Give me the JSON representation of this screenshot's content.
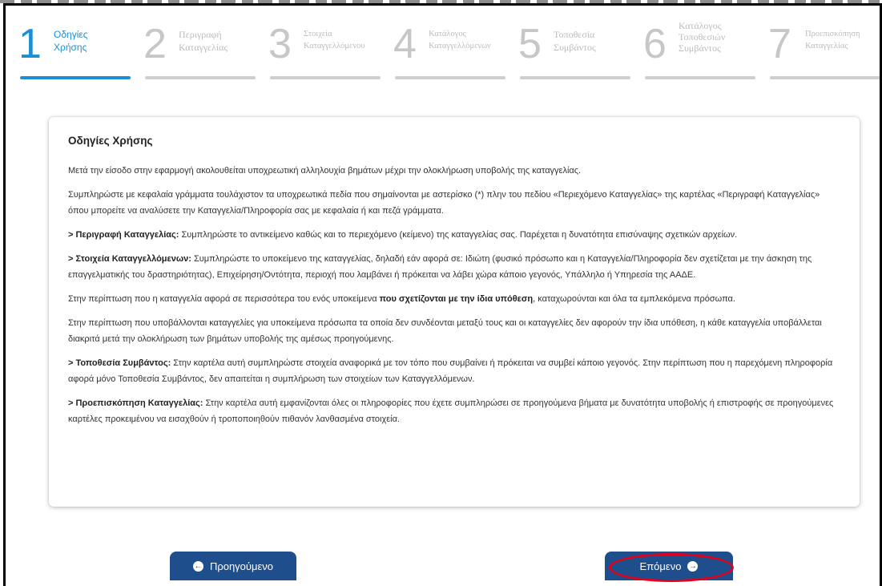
{
  "steps": [
    {
      "num": "1",
      "label_line1": "Οδηγίες",
      "label_line2": "Χρήσης"
    },
    {
      "num": "2",
      "label_line1": "Περιγραφή",
      "label_line2": "Καταγγελίας"
    },
    {
      "num": "3",
      "label_line1": "Στοιχεία",
      "label_line2": "Καταγγελλόμενου"
    },
    {
      "num": "4",
      "label_line1": "Κατάλογος",
      "label_line2": "Καταγγελλόμενων"
    },
    {
      "num": "5",
      "label_line1": "Τοποθεσία",
      "label_line2": "Συμβάντος"
    },
    {
      "num": "6",
      "label_line1": "Κατάλογος",
      "label_line2": "Τοποθεσιών",
      "label_line3": "Συμβάντος"
    },
    {
      "num": "7",
      "label_line1": "Προεπισκόπηση",
      "label_line2": "Καταγγελίας"
    }
  ],
  "colors": {
    "active": "#1a8fd6",
    "inactive": "#c7c7c7",
    "button": "#1f4e8c",
    "highlight": "#e3001b"
  },
  "card": {
    "title": "Οδηγίες Χρήσης",
    "p1": "Μετά την είσοδο στην εφαρμογή ακολουθείται υποχρεωτική αλληλουχία βημάτων μέχρι την ολοκλήρωση υποβολής της καταγγελίας.",
    "p2": "Συμπληρώστε με κεφαλαία γράμματα τουλάχιστον τα υποχρεωτικά πεδία που σημαίνονται με αστερίσκο (*) πλην του πεδίου «Περιεχόμενο Καταγγελίας» της καρτέλας «Περιγραφή Καταγγελίας» όπου μπορείτε να αναλύσετε την Καταγγελία/Πληροφορία σας με κεφαλαία ή και πεζά γράμματα.",
    "p3_bold": "> Περιγραφή Καταγγελίας:",
    "p3_text": " Συμπληρώστε το αντικείμενο καθώς και το περιεχόμενο (κείμενο) της καταγγελίας σας. Παρέχεται η δυνατότητα επισύναψης σχετικών αρχείων.",
    "p4_bold": "> Στοιχεία Καταγγελλόμενων:",
    "p4_text": " Συμπληρώστε το υποκείμενο της καταγγελίας, δηλαδή εάν αφορά σε: Ιδιώτη (φυσικό πρόσωπο και η Καταγγελία/Πληροφορία δεν σχετίζεται με την άσκηση της επαγγελματικής του δραστηριότητας), Επιχείρηση/Οντότητα, περιοχή που λαμβάνει ή πρόκειται να λάβει χώρα κάποιο γεγονός, Υπάλληλο ή Υπηρεσία της ΑΑΔΕ.",
    "p5_pre": "Στην περίπτωση που η καταγγελία αφορά σε περισσότερα του ενός υποκείμενα ",
    "p5_bold": "που σχετίζονται με την ίδια υπόθεση",
    "p5_post": ", καταχωρούνται και όλα τα εμπλεκόμενα πρόσωπα.",
    "p6": "Στην περίπτωση που υποβάλλονται καταγγελίες για υποκείμενα πρόσωπα τα οποία δεν συνδέονται μεταξύ τους και οι καταγγελίες δεν αφορούν την ίδια υπόθεση, η κάθε καταγγελία υποβάλλεται διακριτά μετά την ολοκλήρωση των βημάτων υποβολής της αμέσως προηγούμενης.",
    "p7_bold": "> Τοποθεσία Συμβάντος:",
    "p7_text": " Στην καρτέλα αυτή συμπληρώστε στοιχεία αναφορικά με τον τόπο που συμβαίνει ή πρόκειται να συμβεί κάποιο γεγονός. Στην περίπτωση που η παρεχόμενη πληροφορία αφορά μόνο Τοποθεσία Συμβάντος, δεν απαιτείται η συμπλήρωση των στοιχείων των Καταγγελλόμενων.",
    "p8_bold": "> Προεπισκόπηση Καταγγελίας:",
    "p8_text": " Στην καρτέλα αυτή εμφανίζονται όλες οι πληροφορίες που έχετε συμπληρώσει σε προηγούμενα βήματα με δυνατότητα υποβολής ή επιστροφής σε προηγούμενες καρτέλες προκειμένου να εισαχθούν ή τροποποιηθούν πιθανόν λανθασμένα στοιχεία."
  },
  "buttons": {
    "prev_label": "Προηγούμενο",
    "next_label": "Επόμενο",
    "prev_icon": "arrow-left-circle-icon",
    "next_icon": "arrow-right-circle-icon"
  }
}
